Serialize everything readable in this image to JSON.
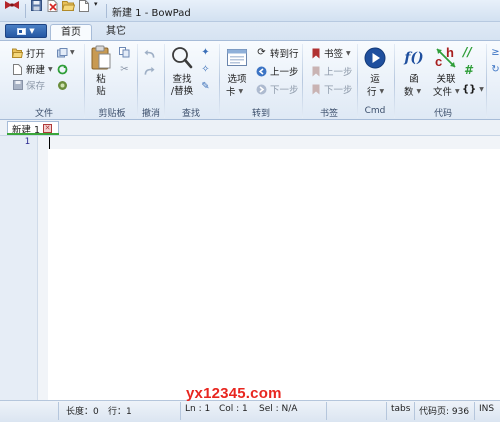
{
  "window": {
    "title": "新建 1 - BowPad"
  },
  "quick_access": [
    "app-icon",
    "save-icon",
    "close-doc-icon",
    "open-folder-icon",
    "new-doc-icon",
    "customize-dropdown-icon"
  ],
  "tabs": {
    "home": "首页",
    "other": "其它"
  },
  "ribbon": {
    "file": {
      "label": "文件",
      "open": "打开",
      "new": "新建",
      "save": "保存"
    },
    "clipboard": {
      "label": "剪贴板",
      "paste_line1": "粘",
      "paste_line2": "贴"
    },
    "undo": {
      "label": "撤消"
    },
    "find": {
      "label": "查找",
      "find_replace_line1": "查找",
      "find_replace_line2": "/替换"
    },
    "goto": {
      "label": "转到",
      "tabs_line1": "选项",
      "tabs_line2": "卡",
      "goto_line": "转到行",
      "prev": "上一步",
      "next": "下一步"
    },
    "bookmarks": {
      "label": "书签",
      "bookmark": "书签",
      "prev": "上一步",
      "next": "下一步"
    },
    "cmd": {
      "label": "Cmd",
      "run_line1": "运",
      "run_line2": "行"
    },
    "code": {
      "label": "代码",
      "func_line1": "函",
      "func_line2": "数",
      "corr_line1": "关联",
      "corr_line2": "文件",
      "func_symbol": "f()",
      "comment_symbol": "//",
      "hash_symbol": "#",
      "braces_symbol": "{}"
    }
  },
  "document_tab": {
    "label": "新建 1"
  },
  "editor": {
    "line_numbers": [
      "1"
    ]
  },
  "status": {
    "length": "长度：0",
    "lines": "行：1",
    "ln": "Ln : 1",
    "col": "Col : 1",
    "sel": "Sel : N/A",
    "tabs": "tabs",
    "codepage": "代码页: 936",
    "ins": "INS"
  },
  "watermark": "yx12345.com",
  "colors": {
    "ribbon_bg": "#eaf1f9",
    "app_button": "#2457a3",
    "tab_underline": "#3aa63a",
    "line_number": "#2b2b91",
    "watermark": "#e8261f"
  }
}
